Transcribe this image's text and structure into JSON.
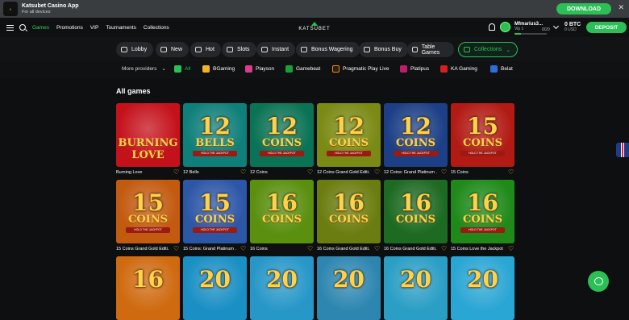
{
  "app_banner": {
    "title": "Katsubet Casino App",
    "subtitle": "For all devices",
    "download_label": "DOWNLOAD",
    "close_icon": "close-icon"
  },
  "header": {
    "nav": [
      "Games",
      "Promotions",
      "VIP",
      "Tournaments",
      "Collections"
    ],
    "active_nav": "Games",
    "brand": "KATSUBET",
    "user": {
      "name": "Mfmarius3...",
      "vip": "Vip 1",
      "progress_count": "0/20",
      "progress_fraction": 0.0
    },
    "balance": {
      "amount": "0 BTC",
      "usd": "0 USD"
    },
    "deposit_label": "DEPOSIT",
    "accent": "#2bbf56"
  },
  "categories": [
    "Lobby",
    "New",
    "Hot",
    "Slots",
    "Instant",
    "Bonus Wagering",
    "Bonus Buy",
    "Table Games",
    "Collections"
  ],
  "providers": {
    "more_label": "More providers",
    "items": [
      "All",
      "BGaming",
      "Playson",
      "Gamebeat",
      "Pragmatic Play Live",
      "Platipus",
      "KA Gaming",
      "Belat"
    ]
  },
  "section_title": "All games",
  "games": [
    {
      "name": "Burning Love",
      "num": "",
      "word": "BURNING LOVE",
      "tag": "",
      "bg": "#c4121c"
    },
    {
      "name": "12 Bells",
      "num": "12",
      "word": "BELLS",
      "tag": "HOLD THE JACKPOT",
      "bg": "#0f7f7a"
    },
    {
      "name": "12 Coins",
      "num": "12",
      "word": "COINS",
      "tag": "HOLD THE JACKPOT",
      "bg": "#0b7355"
    },
    {
      "name": "12 Coins Grand Gold Editi...",
      "num": "12",
      "word": "COINS",
      "tag": "HOLD THE JACKPOT",
      "bg": "#7a8a14"
    },
    {
      "name": "12 Coins: Grand Platinum ...",
      "num": "12",
      "word": "COINS",
      "tag": "HOLD THE JACKPOT",
      "bg": "#1c3f86"
    },
    {
      "name": "15 Coins",
      "num": "15",
      "word": "COINS",
      "tag": "HOLD THE JACKPOT",
      "bg": "#b21a14"
    },
    {
      "name": "15 Coins Grand Gold Editi...",
      "num": "15",
      "word": "COINS",
      "tag": "HOLD THE JACKPOT",
      "bg": "#c25a10"
    },
    {
      "name": "15 Coins: Grand Platinum ...",
      "num": "15",
      "word": "COINS",
      "tag": "HOLD THE JACKPOT",
      "bg": "#2c56a6"
    },
    {
      "name": "16 Coins",
      "num": "16",
      "word": "COINS",
      "tag": "",
      "bg": "#5a8f10"
    },
    {
      "name": "16 Coins Grand Gold Editi...",
      "num": "16",
      "word": "COINS",
      "tag": "",
      "bg": "#6b7d10"
    },
    {
      "name": "16 Coins Grand Gold Editi...",
      "num": "16",
      "word": "COINS",
      "tag": "",
      "bg": "#1d6a22"
    },
    {
      "name": "15 Coins Love the Jackpot",
      "num": "16",
      "word": "COINS",
      "tag": "HOLD THE JACKPOT",
      "bg": "#1f8a1a"
    },
    {
      "name": "",
      "num": "16",
      "word": "",
      "tag": "",
      "bg": "#cf6a10"
    },
    {
      "name": "",
      "num": "20",
      "word": "",
      "tag": "",
      "bg": "#1a8fc4"
    },
    {
      "name": "",
      "num": "20",
      "word": "",
      "tag": "",
      "bg": "#2797c8"
    },
    {
      "name": "",
      "num": "20",
      "word": "",
      "tag": "",
      "bg": "#2d86b0"
    },
    {
      "name": "",
      "num": "20",
      "word": "",
      "tag": "",
      "bg": "#2a9ec5"
    },
    {
      "name": "",
      "num": "20",
      "word": "",
      "tag": "",
      "bg": "#2aa6d4"
    }
  ]
}
